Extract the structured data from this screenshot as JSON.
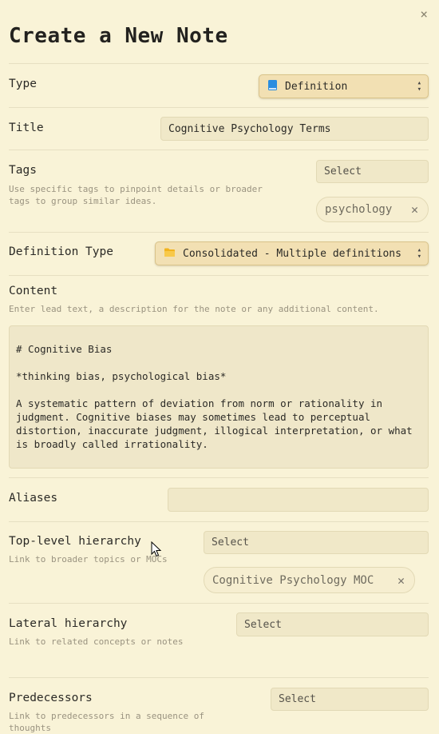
{
  "dialog": {
    "title": "Create a New Note",
    "close_glyph": "×"
  },
  "type": {
    "label": "Type",
    "value": "Definition",
    "icon": "blue-book-icon"
  },
  "title_field": {
    "label": "Title",
    "value": "Cognitive Psychology Terms"
  },
  "tags": {
    "label": "Tags",
    "hint_line1": "Use specific tags to pinpoint details or broader",
    "hint_line2": "tags to group similar ideas.",
    "placeholder": "Select",
    "chips": [
      "psychology"
    ]
  },
  "definition_type": {
    "label": "Definition Type",
    "value": "Consolidated - Multiple definitions",
    "icon": "folder-icon"
  },
  "content": {
    "label": "Content",
    "hint": "Enter lead text, a description for the note or any additional content.",
    "text": "# Cognitive Bias\n\n*thinking bias, psychological bias*\n\nA systematic pattern of deviation from norm or rationality in\njudgment. Cognitive biases may sometimes lead to perceptual\ndistortion, inaccurate judgment, illogical interpretation, or what\nis broadly called irrationality."
  },
  "aliases": {
    "label": "Aliases",
    "value": ""
  },
  "top_level": {
    "label": "Top-level hierarchy",
    "hint": "Link to broader topics or MOCs",
    "placeholder": "Select",
    "chips": [
      "Cognitive Psychology MOC"
    ]
  },
  "lateral": {
    "label": "Lateral hierarchy",
    "hint": "Link to related concepts or notes",
    "placeholder": "Select"
  },
  "predecessors": {
    "label": "Predecessors",
    "hint_line1": "Link to predecessors in a sequence of",
    "hint_line2": "thoughts",
    "placeholder": "Select"
  },
  "colors": {
    "background": "#f9f3d7",
    "field": "#f0e8c8",
    "select_button": "#f2e0b3"
  }
}
